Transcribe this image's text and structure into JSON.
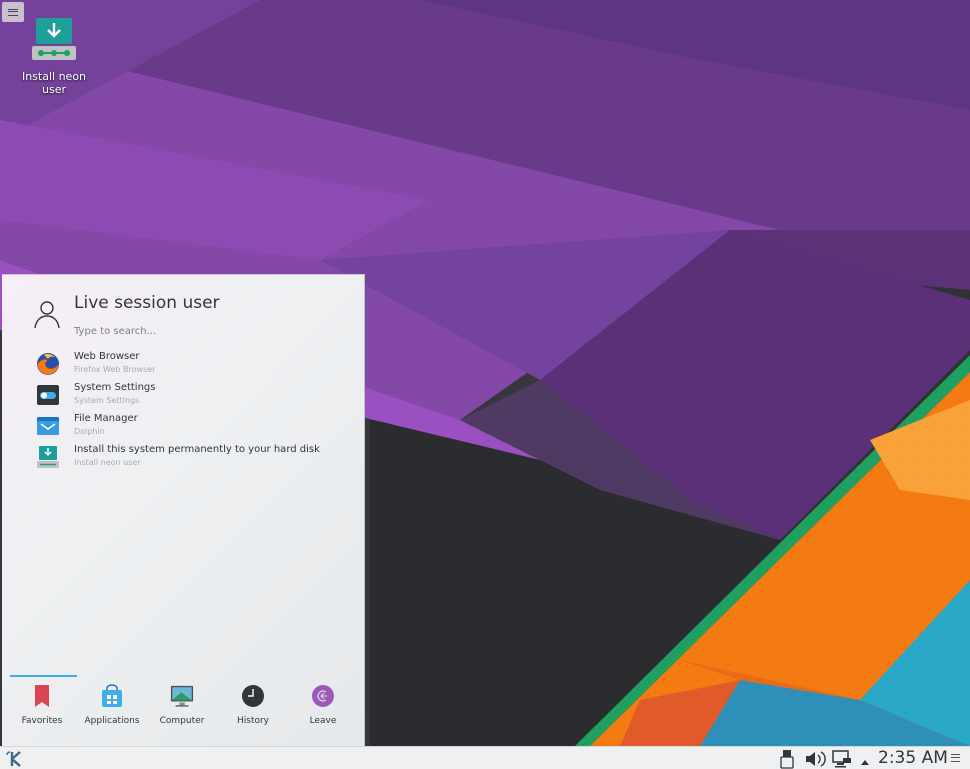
{
  "desktop": {
    "icon_label": "Install neon user"
  },
  "launcher": {
    "user_name": "Live session user",
    "search_placeholder": "Type to search...",
    "favorites": [
      {
        "title": "Web Browser",
        "subtitle": "Firefox Web Browser",
        "icon": "firefox-icon"
      },
      {
        "title": "System Settings",
        "subtitle": "System Settings",
        "icon": "system-settings-icon"
      },
      {
        "title": "File Manager",
        "subtitle": "Dolphin",
        "icon": "dolphin-folder-icon"
      },
      {
        "title": "Install this system permanently to your hard disk",
        "subtitle": "Install neon user",
        "icon": "installer-icon"
      }
    ],
    "tabs": [
      {
        "label": "Favorites",
        "icon": "bookmark-icon",
        "active": true
      },
      {
        "label": "Applications",
        "icon": "applications-icon"
      },
      {
        "label": "Computer",
        "icon": "computer-icon"
      },
      {
        "label": "History",
        "icon": "clock-icon"
      },
      {
        "label": "Leave",
        "icon": "leave-icon"
      }
    ]
  },
  "panel": {
    "clock": "2:35 AM"
  },
  "colors": {
    "accent": "#3daee9",
    "wallpaper_purple": "#7a3e9d",
    "wallpaper_orange": "#f47a12",
    "wallpaper_green": "#1fa060"
  }
}
